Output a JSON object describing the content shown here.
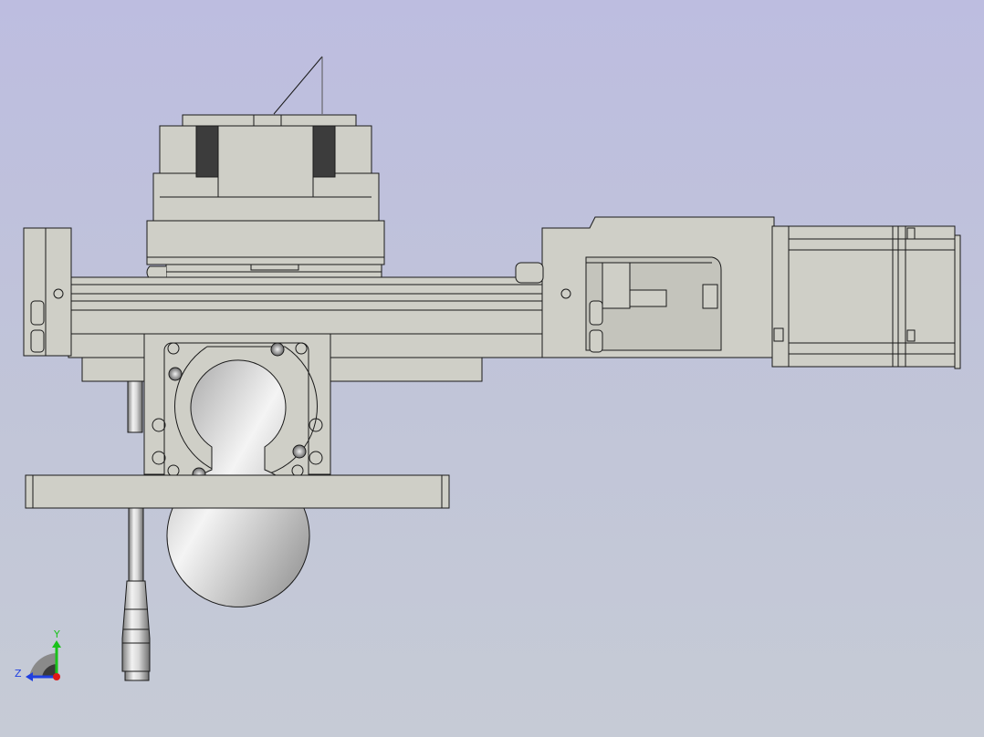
{
  "view": {
    "background_top": "#bdbde0",
    "background_bottom": "#c6cbd6",
    "part_color": "#cfcfc7",
    "edge_color": "#1a1a1a"
  },
  "triad": {
    "y_label": "Y",
    "z_label": "Z",
    "y_color": "#19c21a",
    "z_color": "#1f3fe0",
    "x_color": "#e01818"
  }
}
